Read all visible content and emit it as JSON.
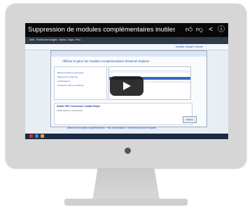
{
  "video": {
    "title": "Suppression de modules complémentaires inutiles dans Inte",
    "icons": [
      "like-icon",
      "dislike-icon",
      "share-icon",
      "info-icon"
    ]
  },
  "browser": {
    "toolbar_items": [
      "Web",
      "Recherche",
      "Images",
      "Vidéos",
      "Maps",
      "Plus"
    ],
    "addon_link": "Installer Google Chrome",
    "dialog_heading": "Afficher et gérer les modules complémentaires d'Internet Explorer",
    "left_pane_items": [
      "Barres d'outils et extensions",
      "Moteurs de recherche",
      "Accélérateurs",
      "Protection contre le tracking"
    ],
    "details_title": "Adobe PDF Conversion Toolbar Helper",
    "details_text": "Adobe Systems, Incorporated",
    "close_label": "Fermer",
    "bottom_links": "Afficher les modules complémentaires · Plus d'informations · Rechercher plus de modules"
  },
  "colors": {
    "accent": "#316ac5",
    "link": "#1a57c8"
  }
}
